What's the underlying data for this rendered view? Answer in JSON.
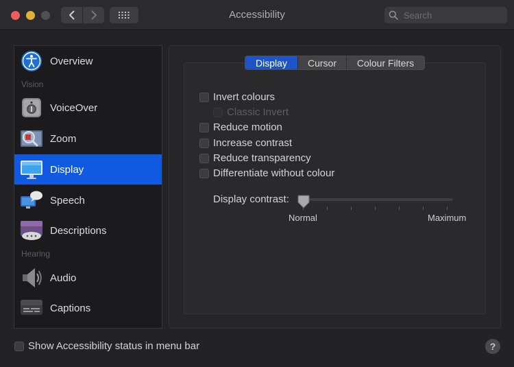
{
  "window": {
    "title": "Accessibility",
    "search_placeholder": "Search"
  },
  "sidebar": {
    "overview": "Overview",
    "section_vision": "Vision",
    "voiceover": "VoiceOver",
    "zoom": "Zoom",
    "display": "Display",
    "speech": "Speech",
    "descriptions": "Descriptions",
    "section_hearing": "Hearing",
    "audio": "Audio",
    "captions": "Captions",
    "selected": "Display"
  },
  "tabs": {
    "display": "Display",
    "cursor": "Cursor",
    "colour_filters": "Colour Filters",
    "active": "Display"
  },
  "options": {
    "invert_colours": "Invert colours",
    "classic_invert": "Classic Invert",
    "reduce_motion": "Reduce motion",
    "increase_contrast": "Increase contrast",
    "reduce_transparency": "Reduce transparency",
    "differentiate_without_colour": "Differentiate without colour"
  },
  "contrast": {
    "label": "Display contrast:",
    "min_label": "Normal",
    "max_label": "Maximum",
    "value": 0
  },
  "footer": {
    "status_label": "Show Accessibility status in menu bar",
    "help": "?"
  },
  "colors": {
    "accent": "#0f5ae0",
    "tab_active": "#1d55c8",
    "close": "#ec5f5a",
    "minimize": "#e0b13a"
  }
}
